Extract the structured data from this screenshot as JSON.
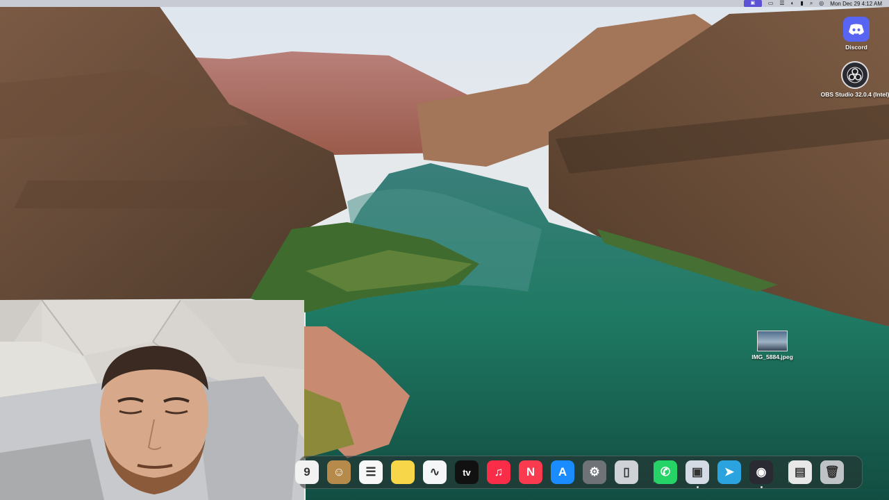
{
  "menubar": {
    "clock": "Mon Dec 29 4:12 AM",
    "icons": [
      "apple-icon",
      "screen-record-icon",
      "display-icon",
      "control-center-icon",
      "focus-icon",
      "battery-icon",
      "search-icon",
      "siri-icon"
    ]
  },
  "desktop": {
    "icons": [
      {
        "name": "discord",
        "label": "Discord"
      },
      {
        "name": "obs",
        "label": "OBS Studio 32.0.4 (Intel)"
      },
      {
        "name": "image-file",
        "label": "IMG_5884.jpeg"
      }
    ]
  },
  "dock": {
    "items": [
      {
        "name": "calendar",
        "glyph": "9",
        "color": "#f2f2f2"
      },
      {
        "name": "contacts",
        "glyph": "☺",
        "color": "#b58a4a"
      },
      {
        "name": "reminders",
        "glyph": "☰",
        "color": "#f7f7f7"
      },
      {
        "name": "notes",
        "glyph": "",
        "color": "#f8d64a"
      },
      {
        "name": "freeform",
        "glyph": "∿",
        "color": "#f4f6f8"
      },
      {
        "name": "apple-tv",
        "glyph": "tv",
        "color": "#111111"
      },
      {
        "name": "music",
        "glyph": "♫",
        "color": "#fa2d48"
      },
      {
        "name": "news",
        "glyph": "N",
        "color": "#fa3a4e"
      },
      {
        "name": "app-store",
        "glyph": "A",
        "color": "#1a8cff"
      },
      {
        "name": "system-settings",
        "glyph": "⚙",
        "color": "#6f7378"
      },
      {
        "name": "iphone-mirroring",
        "glyph": "▯",
        "color": "#cfd3d8"
      },
      {
        "name": "whatsapp",
        "glyph": "✆",
        "color": "#25d366"
      },
      {
        "name": "preview",
        "glyph": "▣",
        "color": "#d5dbe4"
      },
      {
        "name": "telegram",
        "glyph": "➤",
        "color": "#2aa3df"
      },
      {
        "name": "obs-studio",
        "glyph": "◉",
        "color": "#2a2a33"
      },
      {
        "name": "downloads-stack",
        "glyph": "▤",
        "color": "#e8e8e8"
      },
      {
        "name": "trash",
        "glyph": "🗑",
        "color": "#bfc3c6"
      }
    ]
  },
  "colors": {
    "sky": "#c9d6e2",
    "rock": "#8a5a3c",
    "water": "#1f7a63",
    "menubar_active": "#5b52d6"
  }
}
